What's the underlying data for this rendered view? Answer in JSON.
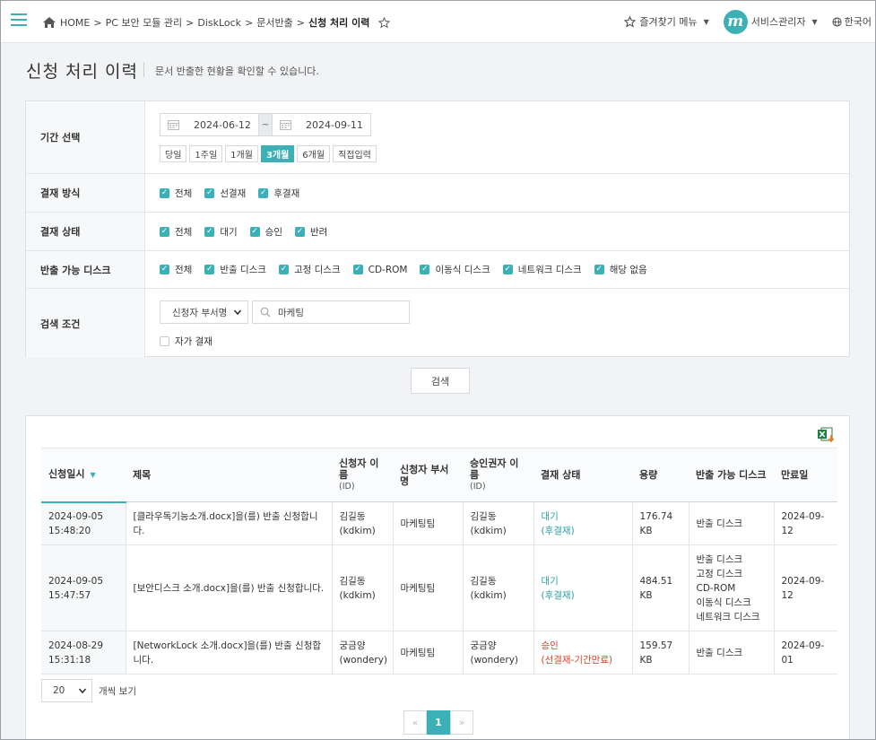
{
  "header": {
    "breadcrumb": [
      "HOME",
      "PC 보안 모듈 관리",
      "DiskLock",
      "문서반출",
      "신청 처리 이력"
    ],
    "favorites_label": "즐겨찾기 메뉴",
    "avatar_letter": "m",
    "user_label": "서비스관리자",
    "language_label": "한국어"
  },
  "page": {
    "title": "신청 처리 이력",
    "description": "문서 반출한 현황을 확인할 수 있습니다."
  },
  "filters": {
    "period": {
      "label": "기간 선택",
      "start_date": "2024-06-12",
      "end_date": "2024-09-11",
      "separator": "~",
      "buttons": [
        "당일",
        "1주일",
        "1개월",
        "3개월",
        "6개월",
        "직접입력"
      ],
      "active_button": "3개월"
    },
    "approval_method": {
      "label": "결재 방식",
      "options": [
        {
          "label": "전체",
          "checked": true
        },
        {
          "label": "선결재",
          "checked": true
        },
        {
          "label": "후결재",
          "checked": true
        }
      ]
    },
    "approval_status": {
      "label": "결재 상태",
      "options": [
        {
          "label": "전체",
          "checked": true
        },
        {
          "label": "대기",
          "checked": true
        },
        {
          "label": "승인",
          "checked": true
        },
        {
          "label": "반려",
          "checked": true
        }
      ]
    },
    "disk": {
      "label": "반출 가능 디스크",
      "options": [
        {
          "label": "전체",
          "checked": true
        },
        {
          "label": "반출 디스크",
          "checked": true
        },
        {
          "label": "고정 디스크",
          "checked": true
        },
        {
          "label": "CD-ROM",
          "checked": true
        },
        {
          "label": "이동식 디스크",
          "checked": true
        },
        {
          "label": "네트워크 디스크",
          "checked": true
        },
        {
          "label": "해당 없음",
          "checked": true
        }
      ]
    },
    "search": {
      "label": "검색 조건",
      "field_select": "신청자 부서명",
      "keyword": "마케팅",
      "self_approval_label": "자가 결재",
      "self_approval_checked": false
    }
  },
  "search_button": "검색",
  "table": {
    "columns": [
      {
        "label": "신청일시",
        "sub": ""
      },
      {
        "label": "제목",
        "sub": ""
      },
      {
        "label": "신청자 이름",
        "sub": "(ID)"
      },
      {
        "label": "신청자 부서명",
        "sub": ""
      },
      {
        "label": "승인권자 이름",
        "sub": "(ID)"
      },
      {
        "label": "결재 상태",
        "sub": ""
      },
      {
        "label": "용량",
        "sub": ""
      },
      {
        "label": "반출 가능 디스크",
        "sub": ""
      },
      {
        "label": "만료일",
        "sub": ""
      }
    ],
    "rows": [
      {
        "date": "2024-09-05 15:48:20",
        "title": "[클라우독기능소개.docx]을(를) 반출 신청합니다.",
        "applicant": "김길동 (kdkim)",
        "department": "마케팅팀",
        "approver": "김길동 (kdkim)",
        "status": "대기",
        "status_detail": "(후결재)",
        "status_type": "wait",
        "size": "176.74 KB",
        "disks": [
          "반출 디스크"
        ],
        "expiry": "2024-09-12"
      },
      {
        "date": "2024-09-05 15:47:57",
        "title": "[보안디스크 소개.docx]을(를) 반출 신청합니다.",
        "applicant": "김길동 (kdkim)",
        "department": "마케팅팀",
        "approver": "김길동 (kdkim)",
        "status": "대기",
        "status_detail": "(후결재)",
        "status_type": "wait",
        "size": "484.51 KB",
        "disks": [
          "반출 디스크",
          "고정 디스크",
          "CD-ROM",
          "이동식 디스크",
          "네트워크 디스크"
        ],
        "expiry": "2024-09-12"
      },
      {
        "date": "2024-08-29 15:31:18",
        "title": "[NetworkLock 소개.docx]을(를) 반출 신청합니다.",
        "applicant": "궁금양 (wondery)",
        "department": "마케팅팀",
        "approver": "궁금양 (wondery)",
        "status": "승인",
        "status_detail": "(선결재-기간만료)",
        "status_type": "ok",
        "size": "159.57 KB",
        "disks": [
          "반출 디스크"
        ],
        "expiry": "2024-09-01"
      }
    ]
  },
  "pagination": {
    "page_size": "20",
    "page_size_suffix": "개씩 보기",
    "prev": "«",
    "next": "»",
    "current_page": "1"
  },
  "colors": {
    "accent": "#3bb0b7",
    "status_wait": "#2a9ea6",
    "status_ok": "#e0402a"
  }
}
